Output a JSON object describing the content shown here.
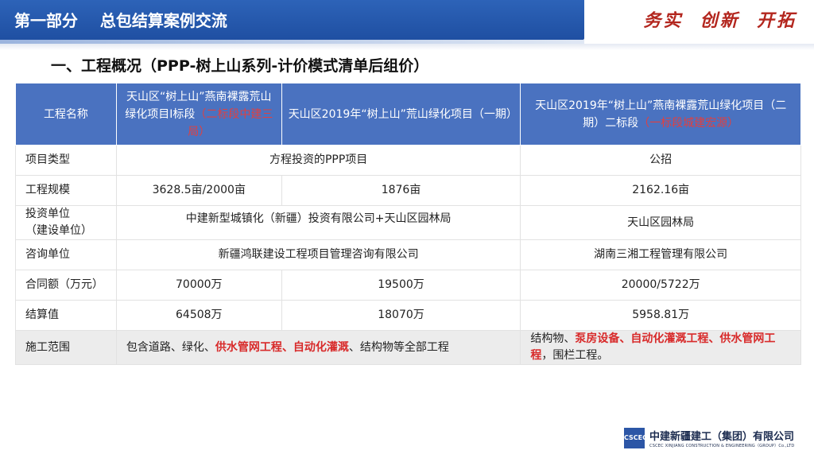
{
  "header": {
    "title": "第一部分    总包结算案例交流",
    "slogan": "务实  创新  开拓"
  },
  "section": {
    "heading": "一、工程概况（PPP-树上山系列-计价模式清单后组价）"
  },
  "table": {
    "header": {
      "col0": "工程名称",
      "col1_main": "天山区“树上山”燕南裸露荒山绿化项目Ⅰ标段",
      "col1_note": "（二标段中建三局）",
      "col2": "天山区2019年“树上山”荒山绿化项目（一期）",
      "col3_main": "天山区2019年“树上山”燕南裸露荒山绿化项目（二期）二标段",
      "col3_note": "（一标段城建宏源）",
      "col3_close": "）"
    },
    "rows": {
      "type": {
        "label": "项目类型",
        "ppp": "方程投资的PPP项目",
        "public": "公招"
      },
      "scale": {
        "label": "工程规模",
        "v1": "3628.5亩/2000亩",
        "v2": "1876亩",
        "v3": "2162.16亩"
      },
      "investor": {
        "label_1": "投资单位",
        "label_2": "（建设单位）",
        "v12": "中建新型城镇化（新疆）投资有限公司+天山区园林局",
        "v3": "天山区园林局"
      },
      "consult": {
        "label": "咨询单位",
        "v12": "新疆鸿联建设工程项目管理咨询有限公司",
        "v3": "湖南三湘工程管理有限公司"
      },
      "contract": {
        "label": "合同额（万元）",
        "v1": "70000万",
        "v2": "19500万",
        "v3": "20000/5722万"
      },
      "settle": {
        "label": "结算值",
        "v1": "64508万",
        "v2": "18070万",
        "v3": "5958.81万"
      },
      "scope": {
        "label": "施工范围",
        "a_pre": "包含道路、绿化、",
        "a_red": "供水管网工程、自动化灌溉",
        "a_post": "、结构物等全部工程",
        "b_pre": "结构物、",
        "b_red": "泵房设备、自动化灌溉工程、供水管网工程",
        "b_post": "，围栏工程。"
      }
    }
  },
  "footer": {
    "logo_mark": "CSCEC",
    "company_cn": "中建新疆建工（集团）有限公司",
    "company_en": "CSCEC XINJIANG CONSTRUCTION & ENGINEERING（GROUP）Co.,LTD"
  }
}
